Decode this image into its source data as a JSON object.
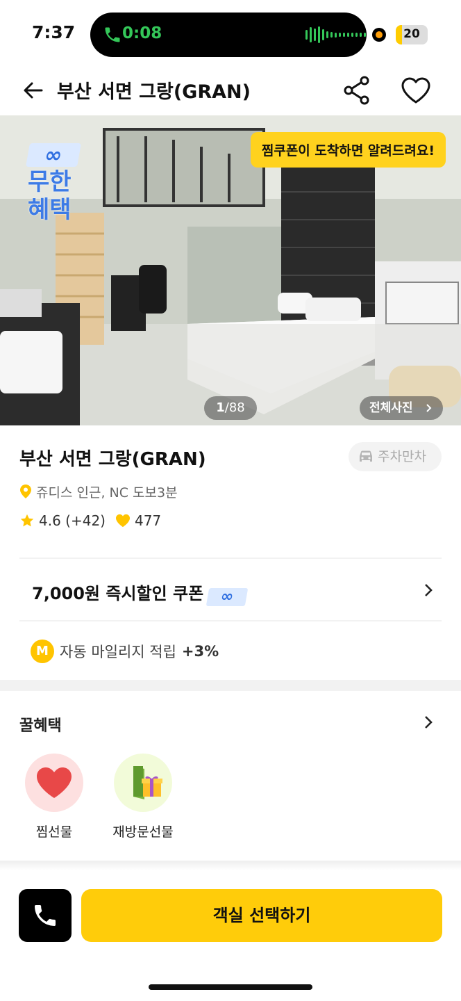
{
  "status": {
    "time": "7:37",
    "call_timer": "0:08",
    "battery_level": "20",
    "battery_fraction": 0.2
  },
  "header": {
    "title": "부산 서면 그랑(GRAN)"
  },
  "hero": {
    "badge_symbol": "∞",
    "badge_line1": "무한",
    "badge_line2": "혜택",
    "tooltip": "찜쿠폰이 도착하면 알려드려요!",
    "counter_current": "1",
    "counter_total": "/88",
    "all_photos": "전체사진"
  },
  "info": {
    "name": "부산 서면 그랑(GRAN)",
    "parking": "주차만차",
    "location": "쥬디스 인근, NC 도보3분",
    "rating": "4.6",
    "review_count": "(+42)",
    "likes": "477"
  },
  "coupon": {
    "label": "7,000원 즉시할인 쿠폰",
    "symbol": "∞"
  },
  "mileage": {
    "badge": "M",
    "label": "자동 마일리지 적립",
    "percent": "+3%"
  },
  "benefits": {
    "title": "꿀혜택",
    "items": [
      {
        "label": "찜선물",
        "icon": "heart-icon",
        "bg": "#fde0e0"
      },
      {
        "label": "재방문선물",
        "icon": "gift-door-icon",
        "bg": "#f2fbd9"
      }
    ]
  },
  "actions": {
    "select_room": "객실 선택하기"
  },
  "colors": {
    "accent": "#ffcc0a",
    "star": "#ffc400",
    "blue_badge": "#2f6fe0"
  }
}
